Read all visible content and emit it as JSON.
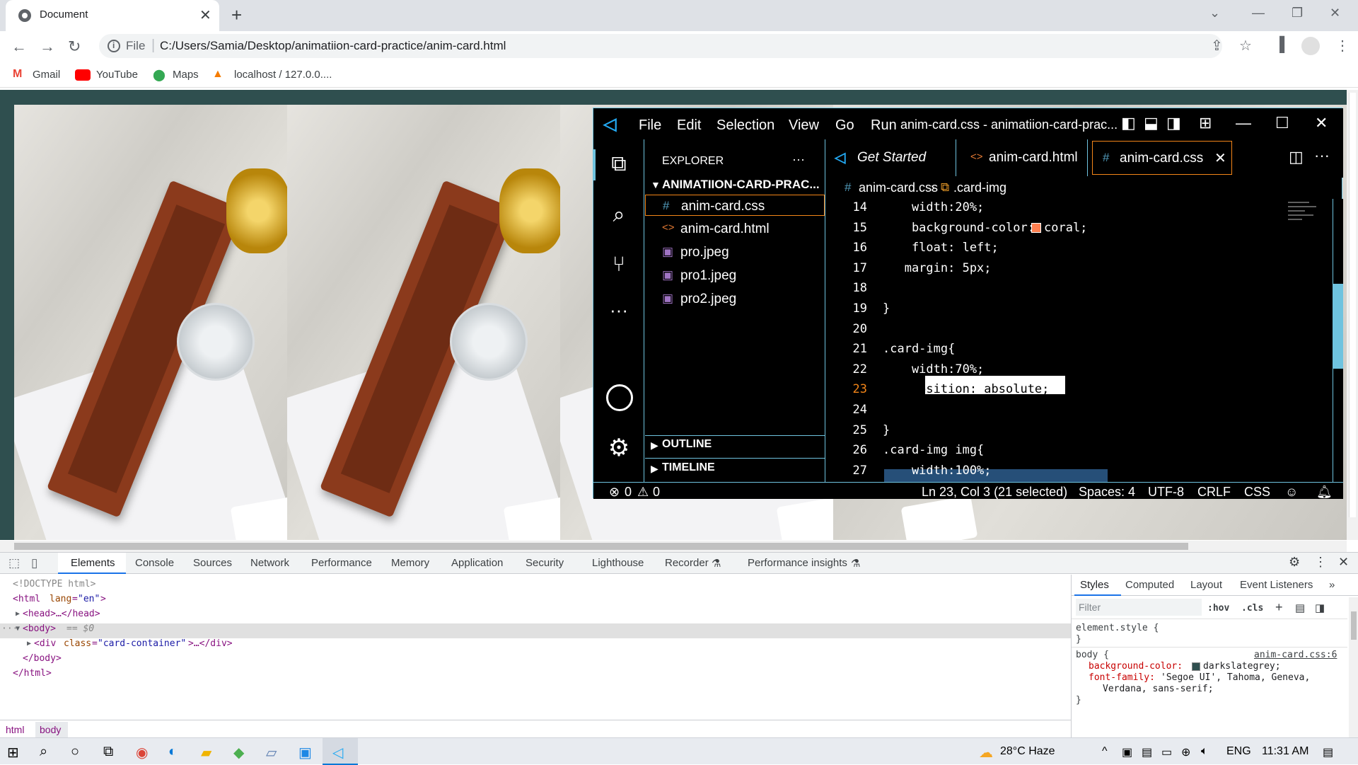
{
  "browser": {
    "tab_title": "Document",
    "tab_close": "✕",
    "new_tab": "+",
    "window_controls": {
      "minimize": "—",
      "restore": "❐",
      "close": "✕",
      "tab_search": "⌄"
    },
    "url_scheme": "File",
    "url": "C:/Users/Samia/Desktop/animatiion-card-practice/anim-card.html",
    "bookmarks": [
      "Gmail",
      "YouTube",
      "Maps",
      "localhost / 127.0.0...."
    ]
  },
  "vscode": {
    "menu": [
      "File",
      "Edit",
      "Selection",
      "View",
      "Go",
      "Run"
    ],
    "window_title": "anim-card.css - animatiion-card-prac...",
    "explorer": {
      "header": "EXPLORER",
      "more": "···",
      "folder": "ANIMATIION-CARD-PRAC...",
      "files": [
        {
          "name": "anim-card.css",
          "icon": "#",
          "color": "#519aba"
        },
        {
          "name": "anim-card.html",
          "icon": "<>",
          "color": "#e37933"
        },
        {
          "name": "pro.jpeg",
          "icon": "▣",
          "color": "#a074c4"
        },
        {
          "name": "pro1.jpeg",
          "icon": "▣",
          "color": "#a074c4"
        },
        {
          "name": "pro2.jpeg",
          "icon": "▣",
          "color": "#a074c4"
        }
      ],
      "outline": "OUTLINE",
      "timeline": "TIMELINE"
    },
    "tabs": [
      {
        "label": "Get Started"
      },
      {
        "label": "anim-card.html"
      },
      {
        "label": "anim-card.css"
      }
    ],
    "breadcrumb": {
      "file": "anim-card.css",
      "symbol": ".card-img"
    },
    "code": [
      {
        "n": "14",
        "t": "    width:20%;"
      },
      {
        "n": "15",
        "t": "    background-color: ",
        "swatch": "#ff7f50",
        "after": "coral;"
      },
      {
        "n": "16",
        "t": "    float: left;"
      },
      {
        "n": "17",
        "t": "   margin: 5px;"
      },
      {
        "n": "18",
        "t": ""
      },
      {
        "n": "19",
        "t": "}"
      },
      {
        "n": "20",
        "t": ""
      },
      {
        "n": "21",
        "t": ".card-img{"
      },
      {
        "n": "22",
        "t": "    width:70%;"
      },
      {
        "n": "23",
        "t": "    position: absolute;"
      },
      {
        "n": "24",
        "t": ""
      },
      {
        "n": "25",
        "t": "}"
      },
      {
        "n": "26",
        "t": ".card-img img{"
      },
      {
        "n": "27",
        "t": "    width:100%;"
      }
    ],
    "status": {
      "errors": "0",
      "warnings": "0",
      "position": "Ln 23, Col 3 (21 selected)",
      "spaces": "Spaces: 4",
      "encoding": "UTF-8",
      "eol": "CRLF",
      "language": "CSS"
    }
  },
  "devtools": {
    "tabs": [
      "Elements",
      "Console",
      "Sources",
      "Network",
      "Performance",
      "Memory",
      "Application",
      "Security",
      "Lighthouse",
      "Recorder",
      "Performance insights"
    ],
    "dom": {
      "doctype": "<!DOCTYPE html>",
      "html_open": "<html",
      "lang_attr": "lang",
      "lang_val": "\"en\"",
      "head": "<head>…</head>",
      "body": "<body>",
      "body_sel": "== $0",
      "div_open": "<div",
      "class_attr": "class",
      "class_val": "\"card-container\"",
      "div_close": ">…</div>",
      "body_close": "</body>",
      "html_close": "</html>"
    },
    "crumbs": [
      "html",
      "body"
    ],
    "styles": {
      "tabs": [
        "Styles",
        "Computed",
        "Layout",
        "Event Listeners"
      ],
      "filter_placeholder": "Filter",
      "hov": ":hov",
      "cls": ".cls",
      "element_style": "element.style {",
      "brace_close": "}",
      "body_selector": "body {",
      "source": "anim-card.css:6",
      "prop1": "background-color:",
      "val1": "darkslategrey;",
      "prop2": "font-family:",
      "val2a": "'Segoe UI', Tahoma, Geneva,",
      "val2b": "Verdana, sans-serif;"
    }
  },
  "taskbar": {
    "weather": "28°C  Haze",
    "lang": "ENG",
    "time": "11:31 AM"
  }
}
